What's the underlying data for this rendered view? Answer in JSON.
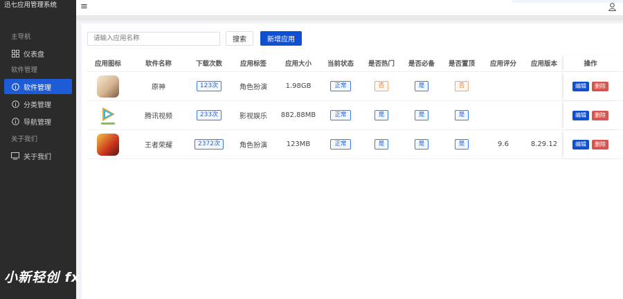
{
  "app": {
    "title": "迅七应用管理系统"
  },
  "sidebar": {
    "groups": [
      {
        "title": "主导航",
        "items": [
          {
            "label": "仪表盘",
            "icon": "grid-icon"
          }
        ]
      },
      {
        "title": "软件管理",
        "items": [
          {
            "label": "软件管理",
            "icon": "info-circle-icon",
            "active": true
          },
          {
            "label": "分类管理",
            "icon": "info-circle-icon"
          },
          {
            "label": "导航管理",
            "icon": "info-circle-icon"
          }
        ]
      },
      {
        "title": "关于我们",
        "items": [
          {
            "label": "关于我们",
            "icon": "monitor-icon"
          }
        ]
      }
    ]
  },
  "watermark": "小新轻创 fx",
  "toolbar": {
    "search_placeholder": "请输入应用名称",
    "search_label": "搜索",
    "add_label": "新增应用"
  },
  "table": {
    "headers": [
      "应用图标",
      "软件名称",
      "下载次数",
      "应用标签",
      "应用大小",
      "当前状态",
      "是否热门",
      "是否必备",
      "是否置顶",
      "应用评分",
      "应用版本",
      "操作"
    ],
    "rows": [
      {
        "icon": "genshin-app-icon",
        "name": "原神",
        "downloads": "123次",
        "tag": "角色扮演",
        "size": "1.98GB",
        "status": "正常",
        "hot": "否",
        "essential": "是",
        "top": "否",
        "rating": "",
        "version": ""
      },
      {
        "icon": "tencent-video-app-icon",
        "name": "腾讯视频",
        "downloads": "233次",
        "tag": "影视娱乐",
        "size": "882.88MB",
        "status": "正常",
        "hot": "是",
        "essential": "是",
        "top": "是",
        "rating": "",
        "version": ""
      },
      {
        "icon": "honor-of-kings-app-icon",
        "name": "王者荣耀",
        "downloads": "2372次",
        "tag": "角色扮演",
        "size": "123MB",
        "status": "正常",
        "hot": "是",
        "essential": "是",
        "top": "是",
        "rating": "9.6",
        "version": "8.29.12"
      }
    ],
    "actions": {
      "edit": "编辑",
      "delete": "删除"
    }
  },
  "colors": {
    "primary": "#0f4fd1",
    "danger": "#d9534f",
    "sidebar_bg": "#2b2b2b",
    "warn": "#e8813a"
  }
}
